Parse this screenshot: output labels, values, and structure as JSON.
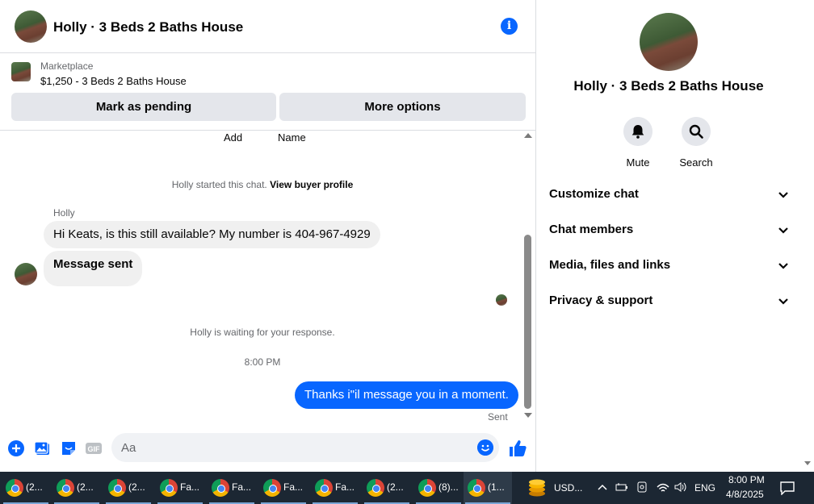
{
  "header": {
    "title": "Holly · 3 Beds 2 Baths House"
  },
  "marketplace": {
    "label": "Marketplace",
    "listing": "$1,250 - 3 Beds 2 Baths House",
    "pending_button": "Mark as pending",
    "more_button": "More options"
  },
  "thread": {
    "cutoff_left": "Add",
    "cutoff_right": "Name",
    "started_text": "Holly started this chat.",
    "view_profile": "View buyer profile",
    "sender": "Holly",
    "message_1": "Hi Keats, is this still available? My number is 404-967-4929",
    "message_2": "Message sent",
    "waiting_text": "Holly is waiting for your response.",
    "time": "8:00 PM",
    "reply": "Thanks i\"il message you in a moment.",
    "status": "Sent"
  },
  "composer": {
    "placeholder": "Aa"
  },
  "side": {
    "title": "Holly · 3 Beds 2 Baths House",
    "mute_label": "Mute",
    "search_label": "Search",
    "sections": [
      "Customize chat",
      "Chat members",
      "Media, files and links",
      "Privacy & support"
    ]
  },
  "taskbar": {
    "items": [
      "(2...",
      "(2...",
      "(2...",
      "Fa...",
      "Fa...",
      "Fa...",
      "Fa...",
      "(2...",
      "(8)...",
      "(1..."
    ],
    "weather": "USD...",
    "language": "ENG",
    "time": "8:00 PM",
    "date": "4/8/2025"
  },
  "colors": {
    "accent": "#0866ff",
    "bubble_in": "#f0f0f0",
    "taskbar": "#1c2733"
  }
}
